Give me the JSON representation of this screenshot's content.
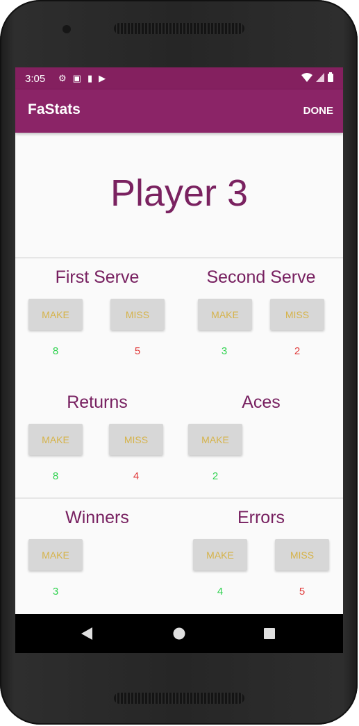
{
  "status_bar": {
    "time": "3:05",
    "icons": [
      "gear-icon",
      "image-icon",
      "sd-card-icon",
      "play-store-icon"
    ],
    "right_icons": [
      "wifi-icon",
      "signal-icon",
      "battery-icon"
    ]
  },
  "app_bar": {
    "title": "FaStats",
    "action": "DONE",
    "color": "#8b2467"
  },
  "player_name": "Player 3",
  "sections": {
    "first_serve": {
      "label": "First Serve",
      "make_label": "MAKE",
      "miss_label": "MISS",
      "make_count": "8",
      "miss_count": "5"
    },
    "second_serve": {
      "label": "Second Serve",
      "make_label": "MAKE",
      "miss_label": "MISS",
      "make_count": "3",
      "miss_count": "2"
    },
    "returns": {
      "label": "Returns",
      "make_label": "MAKE",
      "miss_label": "MISS",
      "make_count": "8",
      "miss_count": "4"
    },
    "aces": {
      "label": "Aces",
      "make_label": "MAKE",
      "make_count": "2"
    },
    "winners": {
      "label": "Winners",
      "make_label": "MAKE",
      "make_count": "3"
    },
    "errors": {
      "label": "Errors",
      "make_label": "MAKE",
      "miss_label": "MISS",
      "make_count": "4",
      "miss_count": "5"
    }
  },
  "colors": {
    "make_count": "#2fd24f",
    "miss_count": "#e03a3a",
    "button_text": "#d6b34a"
  },
  "nav_bar": {
    "icons": [
      "back-icon",
      "home-icon",
      "recents-icon"
    ]
  }
}
